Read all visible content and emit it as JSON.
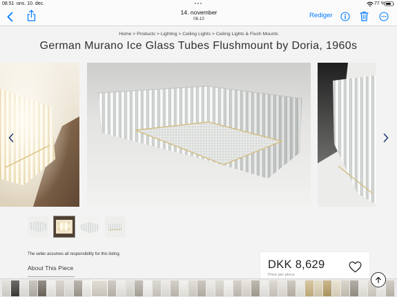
{
  "status_bar": {
    "time": "08.51",
    "date": "ons. 10. dec.",
    "battery_text": "77 %",
    "battery_level": 0.77,
    "icons": [
      "multitasking-dots-icon",
      "wifi-icon",
      "battery-icon"
    ]
  },
  "toolbar": {
    "photo_date": "14. november",
    "photo_time": "06.10",
    "edit_label": "Rediger",
    "icons": [
      "back-chevron-icon",
      "share-icon",
      "info-icon",
      "trash-icon",
      "more-icon"
    ]
  },
  "page": {
    "breadcrumb": {
      "items": [
        "Home",
        "Products",
        "Lighting",
        "Ceiling Lights",
        "Ceiling Lights & Flush Mounts"
      ],
      "separator": ">"
    },
    "title": "German Murano Ice Glass Tubes Flushmount by Doria, 1960s",
    "carousel_icons": [
      "chevron-left-icon",
      "chevron-right-icon"
    ],
    "disclaimer": "The seller assumes all responsibility for this listing.",
    "about_heading": "About This Piece",
    "price": {
      "amount": "DKK 8,629",
      "note": "Price per piece",
      "icon": "heart-icon"
    },
    "scroll_top_icon": "arrow-up-icon"
  },
  "filmstrip": {
    "selected_index": 10,
    "tones": [
      "#dcd9d3",
      "#3f3c38",
      "#e8e6e1",
      "#b9b5ad",
      "#70695f",
      "#efede8",
      "#cfcbc4",
      "#e4e1db",
      "#a39d93",
      "#f2f0ec",
      "#d8d3c9",
      "#c1bcb3",
      "#ecebe7",
      "#e0ddd6",
      "#b1aca2",
      "#f4f3f0",
      "#d2cec6",
      "#e9e6e0",
      "#c6c1b8",
      "#f0eee9",
      "#dad6ce",
      "#bcb7ad",
      "#ebe8e2",
      "#d5d1c9",
      "#f3f2ee",
      "#c9c4bb",
      "#e1ddd5",
      "#aaa497",
      "#eeece7",
      "#d3cec5",
      "#e6e3dc",
      "#bfb9ad",
      "#ece9e2",
      "#cbb682",
      "#ddd2b4",
      "#b89f66",
      "#e5dcc4",
      "#cfc9bc",
      "#9b958a",
      "#ebe8e1",
      "#d6d2c9",
      "#f1f0ec",
      "#c3bdb2"
    ]
  },
  "colors": {
    "accent": "#007aff",
    "carousel_arrow": "#203b73",
    "page_background": "#f3f3f3",
    "toolbar_background": "#fbfbfb"
  }
}
